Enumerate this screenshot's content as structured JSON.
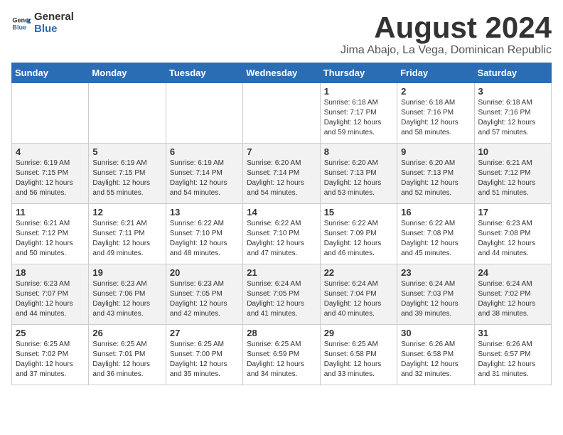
{
  "logo": {
    "general": "General",
    "blue": "Blue"
  },
  "title": "August 2024",
  "subtitle": "Jima Abajo, La Vega, Dominican Republic",
  "days_of_week": [
    "Sunday",
    "Monday",
    "Tuesday",
    "Wednesday",
    "Thursday",
    "Friday",
    "Saturday"
  ],
  "weeks": [
    [
      {
        "day": "",
        "info": ""
      },
      {
        "day": "",
        "info": ""
      },
      {
        "day": "",
        "info": ""
      },
      {
        "day": "",
        "info": ""
      },
      {
        "day": "1",
        "info": "Sunrise: 6:18 AM\nSunset: 7:17 PM\nDaylight: 12 hours and 59 minutes."
      },
      {
        "day": "2",
        "info": "Sunrise: 6:18 AM\nSunset: 7:16 PM\nDaylight: 12 hours and 58 minutes."
      },
      {
        "day": "3",
        "info": "Sunrise: 6:18 AM\nSunset: 7:16 PM\nDaylight: 12 hours and 57 minutes."
      }
    ],
    [
      {
        "day": "4",
        "info": "Sunrise: 6:19 AM\nSunset: 7:15 PM\nDaylight: 12 hours and 56 minutes."
      },
      {
        "day": "5",
        "info": "Sunrise: 6:19 AM\nSunset: 7:15 PM\nDaylight: 12 hours and 55 minutes."
      },
      {
        "day": "6",
        "info": "Sunrise: 6:19 AM\nSunset: 7:14 PM\nDaylight: 12 hours and 54 minutes."
      },
      {
        "day": "7",
        "info": "Sunrise: 6:20 AM\nSunset: 7:14 PM\nDaylight: 12 hours and 54 minutes."
      },
      {
        "day": "8",
        "info": "Sunrise: 6:20 AM\nSunset: 7:13 PM\nDaylight: 12 hours and 53 minutes."
      },
      {
        "day": "9",
        "info": "Sunrise: 6:20 AM\nSunset: 7:13 PM\nDaylight: 12 hours and 52 minutes."
      },
      {
        "day": "10",
        "info": "Sunrise: 6:21 AM\nSunset: 7:12 PM\nDaylight: 12 hours and 51 minutes."
      }
    ],
    [
      {
        "day": "11",
        "info": "Sunrise: 6:21 AM\nSunset: 7:12 PM\nDaylight: 12 hours and 50 minutes."
      },
      {
        "day": "12",
        "info": "Sunrise: 6:21 AM\nSunset: 7:11 PM\nDaylight: 12 hours and 49 minutes."
      },
      {
        "day": "13",
        "info": "Sunrise: 6:22 AM\nSunset: 7:10 PM\nDaylight: 12 hours and 48 minutes."
      },
      {
        "day": "14",
        "info": "Sunrise: 6:22 AM\nSunset: 7:10 PM\nDaylight: 12 hours and 47 minutes."
      },
      {
        "day": "15",
        "info": "Sunrise: 6:22 AM\nSunset: 7:09 PM\nDaylight: 12 hours and 46 minutes."
      },
      {
        "day": "16",
        "info": "Sunrise: 6:22 AM\nSunset: 7:08 PM\nDaylight: 12 hours and 45 minutes."
      },
      {
        "day": "17",
        "info": "Sunrise: 6:23 AM\nSunset: 7:08 PM\nDaylight: 12 hours and 44 minutes."
      }
    ],
    [
      {
        "day": "18",
        "info": "Sunrise: 6:23 AM\nSunset: 7:07 PM\nDaylight: 12 hours and 44 minutes."
      },
      {
        "day": "19",
        "info": "Sunrise: 6:23 AM\nSunset: 7:06 PM\nDaylight: 12 hours and 43 minutes."
      },
      {
        "day": "20",
        "info": "Sunrise: 6:23 AM\nSunset: 7:05 PM\nDaylight: 12 hours and 42 minutes."
      },
      {
        "day": "21",
        "info": "Sunrise: 6:24 AM\nSunset: 7:05 PM\nDaylight: 12 hours and 41 minutes."
      },
      {
        "day": "22",
        "info": "Sunrise: 6:24 AM\nSunset: 7:04 PM\nDaylight: 12 hours and 40 minutes."
      },
      {
        "day": "23",
        "info": "Sunrise: 6:24 AM\nSunset: 7:03 PM\nDaylight: 12 hours and 39 minutes."
      },
      {
        "day": "24",
        "info": "Sunrise: 6:24 AM\nSunset: 7:02 PM\nDaylight: 12 hours and 38 minutes."
      }
    ],
    [
      {
        "day": "25",
        "info": "Sunrise: 6:25 AM\nSunset: 7:02 PM\nDaylight: 12 hours and 37 minutes."
      },
      {
        "day": "26",
        "info": "Sunrise: 6:25 AM\nSunset: 7:01 PM\nDaylight: 12 hours and 36 minutes."
      },
      {
        "day": "27",
        "info": "Sunrise: 6:25 AM\nSunset: 7:00 PM\nDaylight: 12 hours and 35 minutes."
      },
      {
        "day": "28",
        "info": "Sunrise: 6:25 AM\nSunset: 6:59 PM\nDaylight: 12 hours and 34 minutes."
      },
      {
        "day": "29",
        "info": "Sunrise: 6:25 AM\nSunset: 6:58 PM\nDaylight: 12 hours and 33 minutes."
      },
      {
        "day": "30",
        "info": "Sunrise: 6:26 AM\nSunset: 6:58 PM\nDaylight: 12 hours and 32 minutes."
      },
      {
        "day": "31",
        "info": "Sunrise: 6:26 AM\nSunset: 6:57 PM\nDaylight: 12 hours and 31 minutes."
      }
    ]
  ]
}
